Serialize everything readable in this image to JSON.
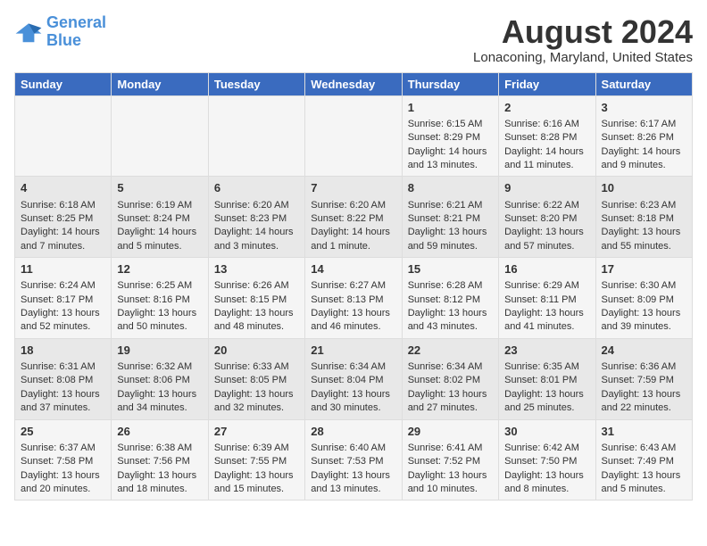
{
  "header": {
    "logo_line1": "General",
    "logo_line2": "Blue",
    "month_year": "August 2024",
    "location": "Lonaconing, Maryland, United States"
  },
  "days_of_week": [
    "Sunday",
    "Monday",
    "Tuesday",
    "Wednesday",
    "Thursday",
    "Friday",
    "Saturday"
  ],
  "weeks": [
    [
      {
        "day": "",
        "content": ""
      },
      {
        "day": "",
        "content": ""
      },
      {
        "day": "",
        "content": ""
      },
      {
        "day": "",
        "content": ""
      },
      {
        "day": "1",
        "content": "Sunrise: 6:15 AM\nSunset: 8:29 PM\nDaylight: 14 hours\nand 13 minutes."
      },
      {
        "day": "2",
        "content": "Sunrise: 6:16 AM\nSunset: 8:28 PM\nDaylight: 14 hours\nand 11 minutes."
      },
      {
        "day": "3",
        "content": "Sunrise: 6:17 AM\nSunset: 8:26 PM\nDaylight: 14 hours\nand 9 minutes."
      }
    ],
    [
      {
        "day": "4",
        "content": "Sunrise: 6:18 AM\nSunset: 8:25 PM\nDaylight: 14 hours\nand 7 minutes."
      },
      {
        "day": "5",
        "content": "Sunrise: 6:19 AM\nSunset: 8:24 PM\nDaylight: 14 hours\nand 5 minutes."
      },
      {
        "day": "6",
        "content": "Sunrise: 6:20 AM\nSunset: 8:23 PM\nDaylight: 14 hours\nand 3 minutes."
      },
      {
        "day": "7",
        "content": "Sunrise: 6:20 AM\nSunset: 8:22 PM\nDaylight: 14 hours\nand 1 minute."
      },
      {
        "day": "8",
        "content": "Sunrise: 6:21 AM\nSunset: 8:21 PM\nDaylight: 13 hours\nand 59 minutes."
      },
      {
        "day": "9",
        "content": "Sunrise: 6:22 AM\nSunset: 8:20 PM\nDaylight: 13 hours\nand 57 minutes."
      },
      {
        "day": "10",
        "content": "Sunrise: 6:23 AM\nSunset: 8:18 PM\nDaylight: 13 hours\nand 55 minutes."
      }
    ],
    [
      {
        "day": "11",
        "content": "Sunrise: 6:24 AM\nSunset: 8:17 PM\nDaylight: 13 hours\nand 52 minutes."
      },
      {
        "day": "12",
        "content": "Sunrise: 6:25 AM\nSunset: 8:16 PM\nDaylight: 13 hours\nand 50 minutes."
      },
      {
        "day": "13",
        "content": "Sunrise: 6:26 AM\nSunset: 8:15 PM\nDaylight: 13 hours\nand 48 minutes."
      },
      {
        "day": "14",
        "content": "Sunrise: 6:27 AM\nSunset: 8:13 PM\nDaylight: 13 hours\nand 46 minutes."
      },
      {
        "day": "15",
        "content": "Sunrise: 6:28 AM\nSunset: 8:12 PM\nDaylight: 13 hours\nand 43 minutes."
      },
      {
        "day": "16",
        "content": "Sunrise: 6:29 AM\nSunset: 8:11 PM\nDaylight: 13 hours\nand 41 minutes."
      },
      {
        "day": "17",
        "content": "Sunrise: 6:30 AM\nSunset: 8:09 PM\nDaylight: 13 hours\nand 39 minutes."
      }
    ],
    [
      {
        "day": "18",
        "content": "Sunrise: 6:31 AM\nSunset: 8:08 PM\nDaylight: 13 hours\nand 37 minutes."
      },
      {
        "day": "19",
        "content": "Sunrise: 6:32 AM\nSunset: 8:06 PM\nDaylight: 13 hours\nand 34 minutes."
      },
      {
        "day": "20",
        "content": "Sunrise: 6:33 AM\nSunset: 8:05 PM\nDaylight: 13 hours\nand 32 minutes."
      },
      {
        "day": "21",
        "content": "Sunrise: 6:34 AM\nSunset: 8:04 PM\nDaylight: 13 hours\nand 30 minutes."
      },
      {
        "day": "22",
        "content": "Sunrise: 6:34 AM\nSunset: 8:02 PM\nDaylight: 13 hours\nand 27 minutes."
      },
      {
        "day": "23",
        "content": "Sunrise: 6:35 AM\nSunset: 8:01 PM\nDaylight: 13 hours\nand 25 minutes."
      },
      {
        "day": "24",
        "content": "Sunrise: 6:36 AM\nSunset: 7:59 PM\nDaylight: 13 hours\nand 22 minutes."
      }
    ],
    [
      {
        "day": "25",
        "content": "Sunrise: 6:37 AM\nSunset: 7:58 PM\nDaylight: 13 hours\nand 20 minutes."
      },
      {
        "day": "26",
        "content": "Sunrise: 6:38 AM\nSunset: 7:56 PM\nDaylight: 13 hours\nand 18 minutes."
      },
      {
        "day": "27",
        "content": "Sunrise: 6:39 AM\nSunset: 7:55 PM\nDaylight: 13 hours\nand 15 minutes."
      },
      {
        "day": "28",
        "content": "Sunrise: 6:40 AM\nSunset: 7:53 PM\nDaylight: 13 hours\nand 13 minutes."
      },
      {
        "day": "29",
        "content": "Sunrise: 6:41 AM\nSunset: 7:52 PM\nDaylight: 13 hours\nand 10 minutes."
      },
      {
        "day": "30",
        "content": "Sunrise: 6:42 AM\nSunset: 7:50 PM\nDaylight: 13 hours\nand 8 minutes."
      },
      {
        "day": "31",
        "content": "Sunrise: 6:43 AM\nSunset: 7:49 PM\nDaylight: 13 hours\nand 5 minutes."
      }
    ]
  ]
}
